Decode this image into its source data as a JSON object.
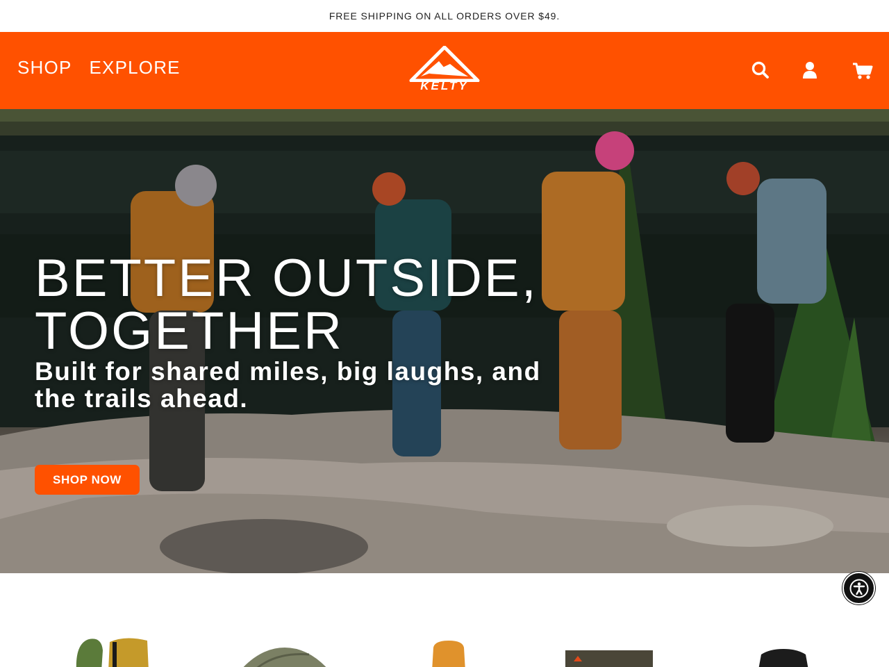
{
  "announcement": {
    "text": "FREE SHIPPING ON ALL ORDERS OVER $49."
  },
  "header": {
    "nav": [
      {
        "label": "SHOP"
      },
      {
        "label": "EXPLORE"
      }
    ],
    "logo_text": "KELTY",
    "icons": [
      "search-icon",
      "account-icon",
      "cart-icon"
    ],
    "brand_color": "#ff5100"
  },
  "hero": {
    "title_line1": "BETTER OUTSIDE,",
    "title_line2": "TOGETHER",
    "subtitle": "Built for shared miles, big laughs, and the trails ahead.",
    "cta_label": "SHOP NOW"
  },
  "accessibility": {
    "icon": "accessibility-icon"
  },
  "products": {
    "items": [
      {
        "icon": "sleeping-bag-image"
      },
      {
        "icon": "tent-image"
      },
      {
        "icon": "backpack-image"
      },
      {
        "icon": "camp-chair-image"
      },
      {
        "icon": "daypack-image"
      }
    ]
  }
}
